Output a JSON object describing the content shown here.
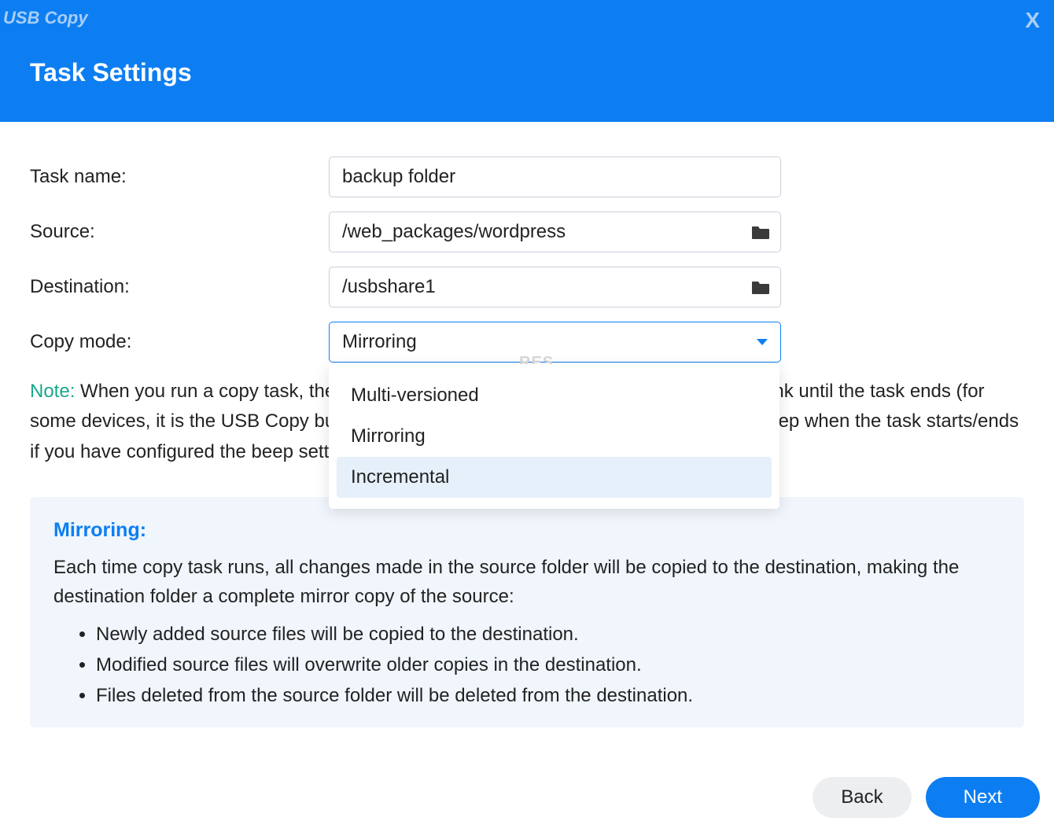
{
  "header": {
    "app_title": "USB Copy",
    "window_title": "Task Settings",
    "close_glyph": "X"
  },
  "form": {
    "task_name_label": "Task name:",
    "task_name_value": "backup folder",
    "source_label": "Source:",
    "source_value": "/web_packages/wordpress",
    "destination_label": "Destination:",
    "destination_value": "/usbshare1",
    "copy_mode_label": "Copy mode:",
    "copy_mode_value": "Mirroring",
    "copy_mode_options": {
      "opt0": "Multi-versioned",
      "opt1": "Mirroring",
      "opt2": "Incremental"
    }
  },
  "note": {
    "label": "Note:",
    "text": " When you run a copy task, the COPY button on your DiskStation will continue to blink until the task ends (for some devices, it is the USB Copy button or STATUS LED instead). You will also hear a beep when the task starts/ends if you have configured the beep setting in USB Copy."
  },
  "info_panel": {
    "title": "Mirroring:",
    "body": "Each time copy task runs, all changes made in the source folder will be copied to the destination, making the destination folder a complete mirror copy of the source:",
    "bullets": {
      "b0": "Newly added source files will be copied to the destination.",
      "b1": "Modified source files will overwrite older copies in the destination.",
      "b2": "Files deleted from the source folder will be deleted from the destination."
    }
  },
  "footer": {
    "back_label": "Back",
    "next_label": "Next"
  },
  "watermark": "RES"
}
